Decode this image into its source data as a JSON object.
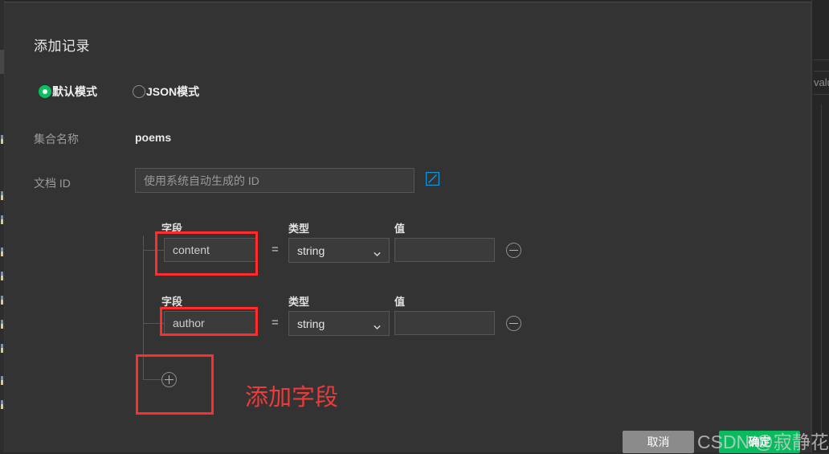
{
  "background": {
    "right_cell_text": "value",
    "left_marks": [
      168,
      238,
      268,
      308,
      338,
      368,
      398,
      428,
      468,
      498
    ]
  },
  "modal": {
    "title": "添加记录",
    "mode_options": [
      {
        "label": "默认模式",
        "selected": true
      },
      {
        "label": "JSON模式",
        "selected": false
      }
    ],
    "collection": {
      "label": "集合名称",
      "value": "poems"
    },
    "doc_id": {
      "label": "文档 ID",
      "placeholder": "使用系统自动生成的 ID",
      "value": "",
      "edit_icon": "edit-square-icon",
      "edit_icon_color": "#1296db"
    },
    "columns": {
      "field": "字段",
      "type": "类型",
      "value": "值"
    },
    "rows": [
      {
        "field": "content",
        "type": "string",
        "value": "",
        "remove_icon": "minus-circle-icon"
      },
      {
        "field": "author",
        "type": "string",
        "value": "",
        "remove_icon": "minus-circle-icon"
      }
    ],
    "add_field_icon": "plus-circle-icon",
    "footer": {
      "cancel": "取消",
      "confirm": "确定"
    }
  },
  "annotations": {
    "add_field_text": "添加字段",
    "color": "#ff2d2d"
  },
  "watermark": "CSDN @寂静花开"
}
